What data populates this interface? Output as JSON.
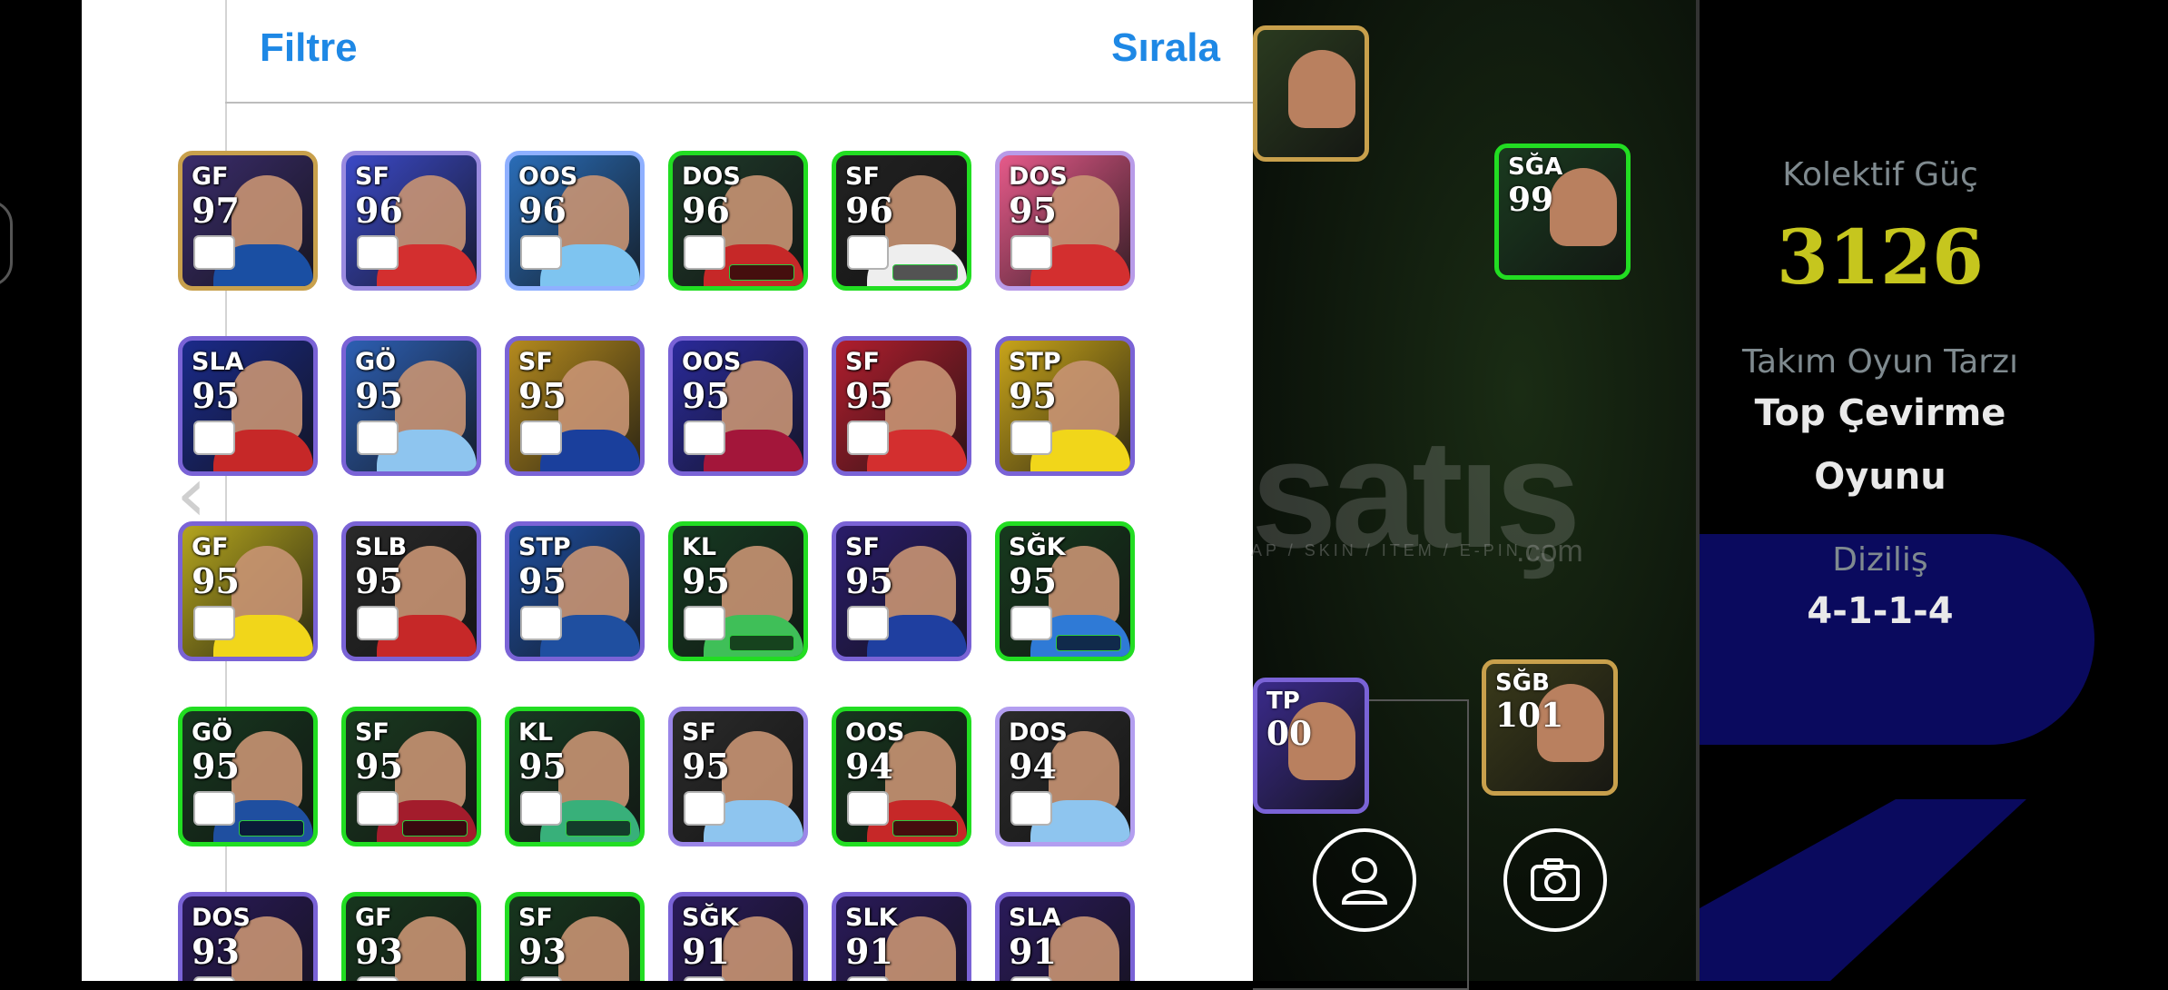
{
  "header": {
    "filter_label": "Filtre",
    "sort_label": "Sırala"
  },
  "back_icon": "chevron-left-icon",
  "player_cards": [
    {
      "pos": "GF",
      "rating": "97",
      "bg": "#3a2c6b",
      "frame": "#c8a04c",
      "kit": "#1a4fa3"
    },
    {
      "pos": "SF",
      "rating": "96",
      "bg": "#3b49c7",
      "frame": "#9a8be0",
      "kit": "#d32f2f"
    },
    {
      "pos": "OOS",
      "rating": "96",
      "bg": "#2a6db8",
      "frame": "#8fb0ff",
      "kit": "#7ec4f0"
    },
    {
      "pos": "DOS",
      "rating": "96",
      "bg": "#1f3a2a",
      "frame": "#22dd22",
      "kit": "#c62828"
    },
    {
      "pos": "SF",
      "rating": "96",
      "bg": "#222",
      "frame": "#22dd22",
      "kit": "#eee"
    },
    {
      "pos": "DOS",
      "rating": "95",
      "bg": "#e65a8a",
      "frame": "#b89be8",
      "kit": "#d32f2f"
    },
    {
      "pos": "SLA",
      "rating": "95",
      "bg": "#1a2a8a",
      "frame": "#7a63d6",
      "kit": "#c62828"
    },
    {
      "pos": "GÖ",
      "rating": "95",
      "bg": "#2d5fb3",
      "frame": "#7a63d6",
      "kit": "#8ec5ef"
    },
    {
      "pos": "SF",
      "rating": "95",
      "bg": "#b48a1e",
      "frame": "#7a63d6",
      "kit": "#1a3f9c"
    },
    {
      "pos": "OOS",
      "rating": "95",
      "bg": "#2a2a9a",
      "frame": "#7a63d6",
      "kit": "#a3163a"
    },
    {
      "pos": "SF",
      "rating": "95",
      "bg": "#b01e2e",
      "frame": "#7a63d6",
      "kit": "#d32f2f"
    },
    {
      "pos": "STP",
      "rating": "95",
      "bg": "#c8a41a",
      "frame": "#7a63d6",
      "kit": "#f1d61a"
    },
    {
      "pos": "GF",
      "rating": "95",
      "bg": "#b4a51e",
      "frame": "#7a63d6",
      "kit": "#f1d61a"
    },
    {
      "pos": "SLB",
      "rating": "95",
      "bg": "#2a2a2a",
      "frame": "#7a63d6",
      "kit": "#c62828"
    },
    {
      "pos": "STP",
      "rating": "95",
      "bg": "#1f4fa0",
      "frame": "#7a63d6",
      "kit": "#1f4fa0"
    },
    {
      "pos": "KL",
      "rating": "95",
      "bg": "#163a22",
      "frame": "#22dd22",
      "kit": "#3fbf58"
    },
    {
      "pos": "SF",
      "rating": "95",
      "bg": "#2a1c6a",
      "frame": "#7a63d6",
      "kit": "#1f3fa0"
    },
    {
      "pos": "SĞK",
      "rating": "95",
      "bg": "#173a1e",
      "frame": "#22dd22",
      "kit": "#2f7ad6"
    },
    {
      "pos": "GÖ",
      "rating": "95",
      "bg": "#17381f",
      "frame": "#22dd22",
      "kit": "#1f4fa0"
    },
    {
      "pos": "SF",
      "rating": "95",
      "bg": "#1a3a20",
      "frame": "#22dd22",
      "kit": "#a31c2c"
    },
    {
      "pos": "KL",
      "rating": "95",
      "bg": "#183a22",
      "frame": "#22dd22",
      "kit": "#38b07a"
    },
    {
      "pos": "SF",
      "rating": "95",
      "bg": "#2b2b2b",
      "frame": "#9b86e8",
      "kit": "#8ec5ef"
    },
    {
      "pos": "OOS",
      "rating": "94",
      "bg": "#17361e",
      "frame": "#22dd22",
      "kit": "#c62828"
    },
    {
      "pos": "DOS",
      "rating": "94",
      "bg": "#2b2b2b",
      "frame": "#b39ef0",
      "kit": "#8ec5ef"
    },
    {
      "pos": "DOS",
      "rating": "93",
      "bg": "#2a1a5a",
      "frame": "#7a63d6",
      "kit": "#222"
    },
    {
      "pos": "GF",
      "rating": "93",
      "bg": "#17361e",
      "frame": "#22dd22",
      "kit": "#c62828"
    },
    {
      "pos": "SF",
      "rating": "93",
      "bg": "#17361e",
      "frame": "#22dd22",
      "kit": "#1f4fa0"
    },
    {
      "pos": "SĞK",
      "rating": "91",
      "bg": "#2a1a5a",
      "frame": "#7a63d6",
      "kit": "#c62828"
    },
    {
      "pos": "SLK",
      "rating": "91",
      "bg": "#2a1a5a",
      "frame": "#7a63d6",
      "kit": "#e0a020"
    },
    {
      "pos": "SLA",
      "rating": "91",
      "bg": "#2a1a5a",
      "frame": "#7a63d6",
      "kit": "#2f7ad6"
    }
  ],
  "lineup_cards": [
    {
      "pos": "",
      "rating": "",
      "bg": "#2a3a1f",
      "frame": "#c8a04c"
    },
    {
      "pos": "SĞA",
      "rating": "99",
      "bg": "#1a3a1f",
      "frame": "#22dd22"
    },
    {
      "pos": "TP",
      "rating": "00",
      "bg": "#3a2a8a",
      "frame": "#7a63d6"
    },
    {
      "pos": "SĞB",
      "rating": "101",
      "bg": "#3a3a1a",
      "frame": "#c8a04c"
    }
  ],
  "watermark": {
    "brand": "satış",
    "tagline": "AP / SKIN / ITEM / E-PIN",
    "domain": ".com"
  },
  "buttons": {
    "profile_icon": "person-icon",
    "camera_icon": "camera-icon"
  },
  "stats": {
    "power_label": "Kolektif Güç",
    "power_value": "3126",
    "style_label": "Takım Oyun Tarzı",
    "style_value_line1": "Top Çevirme",
    "style_value_line2": "Oyunu",
    "formation_label": "Diziliş",
    "formation_value": "4-1-1-4"
  },
  "colors": {
    "accent": "#1e88e5",
    "power": "#c6c61e"
  }
}
